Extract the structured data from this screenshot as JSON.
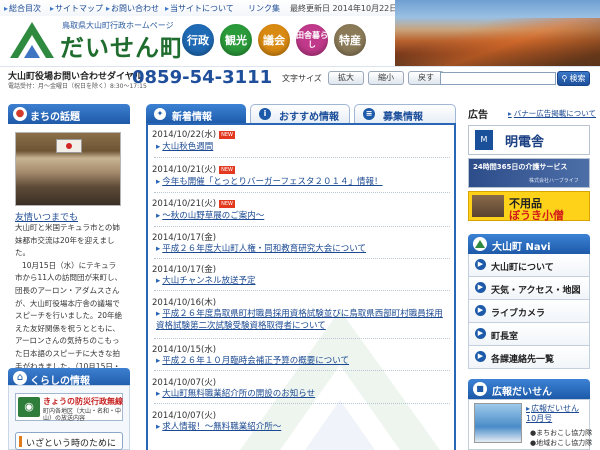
{
  "header": {
    "nav": [
      {
        "label": "総合目次"
      },
      {
        "label": "サイトマップ"
      },
      {
        "label": "お問い合わせ"
      },
      {
        "label": "当サイトについて"
      },
      {
        "label": "リンク集"
      }
    ],
    "updated": "最終更新日 2014年10月22日",
    "subtitle": "鳥取県大山町行政ホームページ",
    "logo_text": "だいせん町",
    "categories": [
      {
        "label": "行政",
        "color": "#1f6ab4"
      },
      {
        "label": "観光",
        "color": "#2a9a3a"
      },
      {
        "label": "議会",
        "color": "#d98a12"
      },
      {
        "label": "田舎暮らし",
        "color": "#c0398a"
      },
      {
        "label": "特産",
        "color": "#8a7a58"
      }
    ]
  },
  "contact": {
    "label": "大山町役場お問い合わせダイヤル",
    "hours": "電話受付：月～金曜日（祝日を除く）8:30～17:15",
    "phone": "0859-54-3111"
  },
  "toolbar": {
    "fontsize_label": "文字サイズ",
    "enlarge": "拡大",
    "shrink": "縮小",
    "reset": "戻す",
    "search_value": "",
    "search_button": "検索"
  },
  "topics": {
    "title": "まちの話題",
    "headline": "友情いつまでも",
    "paragraphs": [
      "大山町と米国テキュラ市との姉妹都市交流は20年を迎えました。",
      "10月15日（水）にテキュラ市から11人の訪問団が来町し、団長のアーロン・アダムスさんが、大山町役場本庁舎の議場でスピーチを行いました。20年絶えた友好関係を祝うとともに、アーロンさんの気持ちのこもった日本語のスピーチに大きな拍手がわきました。（10月15日・撮影）"
    ]
  },
  "life": {
    "title": "くらしの情報",
    "bousai_title": "きょうの防災行政無線",
    "bousai_desc": "町内各地区（大山・名和・中山）の放送内容",
    "itsumo": "いざという時のために"
  },
  "tabs": [
    {
      "label": "新着情報"
    },
    {
      "label": "おすすめ情報"
    },
    {
      "label": "募集情報"
    }
  ],
  "news": [
    {
      "date": "2014/10/22(水)",
      "new": "NEW",
      "title": "大山秋色週間"
    },
    {
      "date": "2014/10/21(火)",
      "new": "NEW",
      "title": "今年も開催「とっとりバーガーフェスタ２０１４」情報！"
    },
    {
      "date": "2014/10/21(火)",
      "new": "NEW",
      "title": "〜秋の山野草展のご案内〜"
    },
    {
      "date": "2014/10/17(金)",
      "new": "",
      "title": "平成２６年度大山町人権・同和教育研究大会について"
    },
    {
      "date": "2014/10/17(金)",
      "new": "",
      "title": "大山チャンネル放送予定"
    },
    {
      "date": "2014/10/16(木)",
      "new": "",
      "title": "平成２６年度鳥取県町村職員採用資格試験並びに鳥取県西部町村職員採用資格試験第二次試験受験資格取得者について"
    },
    {
      "date": "2014/10/15(水)",
      "new": "",
      "title": "平成２６年１０月臨時会補正予算の概要について"
    },
    {
      "date": "2014/10/07(火)",
      "new": "",
      "title": "大山町無料職業紹介所の開設のお知らせ"
    },
    {
      "date": "2014/10/07(火)",
      "new": "",
      "title": "求人情報！〜無料職業紹介所〜"
    }
  ],
  "ads": {
    "label": "広告",
    "link": "バナー広告掲載について",
    "banners": [
      {
        "text": "明電舎",
        "badge": "MEIDEN"
      },
      {
        "text": "24時間365日の介護サービス",
        "sub": "株式会社ハーブライフ"
      },
      {
        "line1": "不用品",
        "line2": "ぼうき小僧"
      }
    ]
  },
  "navi": {
    "title": "大山町 Navi",
    "items": [
      {
        "label": "大山町について"
      },
      {
        "label": "天気・アクセス・地図"
      },
      {
        "label": "ライブカメラ"
      },
      {
        "label": "町長室"
      },
      {
        "label": "各課連絡先一覧"
      }
    ]
  },
  "koho": {
    "title": "広報だいせん",
    "link": "広報だいせん 10月号",
    "sub1": "●まちおこし協力隊",
    "sub2": "●地域おこし協力隊"
  }
}
